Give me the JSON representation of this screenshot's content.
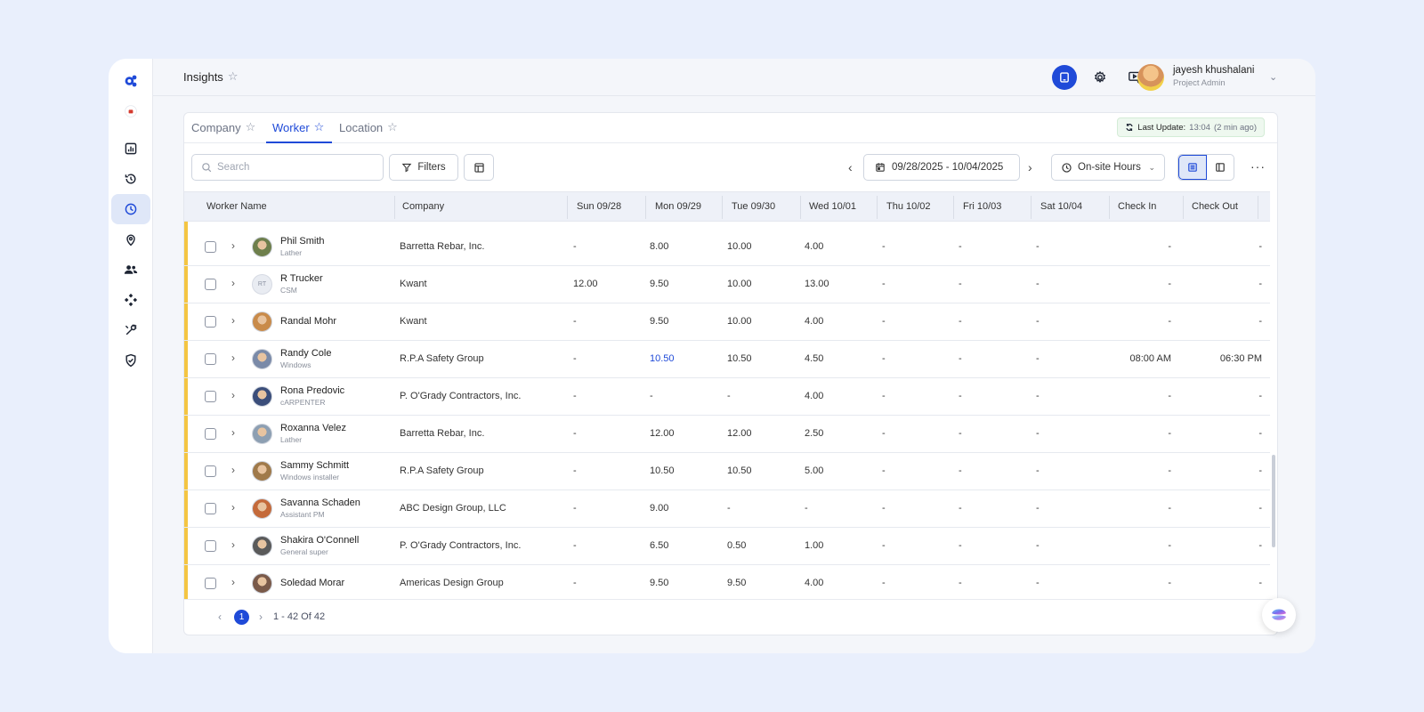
{
  "header": {
    "title": "Insights",
    "user_name": "jayesh khushalani",
    "user_role": "Project Admin"
  },
  "tabs": [
    {
      "label": "Company",
      "active": false
    },
    {
      "label": "Worker",
      "active": true
    },
    {
      "label": "Location",
      "active": false
    }
  ],
  "last_update": {
    "label": "Last Update:",
    "time": "13:04",
    "ago": "(2 min ago)"
  },
  "toolbar": {
    "search_placeholder": "Search",
    "filters_label": "Filters",
    "date_range": "09/28/2025 - 10/04/2025",
    "metric": "On-site Hours",
    "more": "···"
  },
  "table": {
    "columns": [
      "Worker Name",
      "Company",
      "Sun 09/28",
      "Mon 09/29",
      "Tue 09/30",
      "Wed 10/01",
      "Thu 10/02",
      "Fri 10/03",
      "Sat 10/04",
      "Check In",
      "Check Out"
    ],
    "rows": [
      {
        "name": "Phil Smith",
        "role": "Lather",
        "company": "Barretta Rebar, Inc.",
        "days": [
          "-",
          "8.00",
          "10.00",
          "4.00",
          "-",
          "-",
          "-"
        ],
        "check_in": "-",
        "check_out": "-"
      },
      {
        "name": "R Trucker",
        "role": "CSM",
        "initials": "RT",
        "company": "Kwant",
        "days": [
          "12.00",
          "9.50",
          "10.00",
          "13.00",
          "-",
          "-",
          "-"
        ],
        "check_in": "-",
        "check_out": "-"
      },
      {
        "name": "Randal Mohr",
        "role": "",
        "company": "Kwant",
        "days": [
          "-",
          "9.50",
          "10.00",
          "4.00",
          "-",
          "-",
          "-"
        ],
        "check_in": "-",
        "check_out": "-"
      },
      {
        "name": "Randy Cole",
        "role": "Windows",
        "company": "R.P.A Safety Group",
        "days": [
          "-",
          "10.50",
          "10.50",
          "4.50",
          "-",
          "-",
          "-"
        ],
        "check_in": "08:00 AM",
        "check_out": "06:30 PM",
        "highlight_day": 1
      },
      {
        "name": "Rona Predovic",
        "role": "cARPENTER",
        "company": "P. O'Grady Contractors, Inc.",
        "days": [
          "-",
          "-",
          "-",
          "4.00",
          "-",
          "-",
          "-"
        ],
        "check_in": "-",
        "check_out": "-"
      },
      {
        "name": "Roxanna Velez",
        "role": "Lather",
        "company": "Barretta Rebar, Inc.",
        "days": [
          "-",
          "12.00",
          "12.00",
          "2.50",
          "-",
          "-",
          "-"
        ],
        "check_in": "-",
        "check_out": "-"
      },
      {
        "name": "Sammy Schmitt",
        "role": "Windows installer",
        "company": "R.P.A Safety Group",
        "days": [
          "-",
          "10.50",
          "10.50",
          "5.00",
          "-",
          "-",
          "-"
        ],
        "check_in": "-",
        "check_out": "-"
      },
      {
        "name": "Savanna Schaden",
        "role": "Assistant PM",
        "company": "ABC Design Group, LLC",
        "days": [
          "-",
          "9.00",
          "-",
          "-",
          "-",
          "-",
          "-"
        ],
        "check_in": "-",
        "check_out": "-"
      },
      {
        "name": "Shakira O'Connell",
        "role": "General super",
        "company": "P. O'Grady Contractors, Inc.",
        "days": [
          "-",
          "6.50",
          "0.50",
          "1.00",
          "-",
          "-",
          "-"
        ],
        "check_in": "-",
        "check_out": "-"
      },
      {
        "name": "Soledad Morar",
        "role": "",
        "company": "Americas Design Group",
        "days": [
          "-",
          "9.50",
          "9.50",
          "4.00",
          "-",
          "-",
          "-"
        ],
        "check_in": "-",
        "check_out": "-"
      }
    ]
  },
  "pagination": {
    "current_page": "1",
    "info": "1 - 42 Of 42"
  },
  "colors": {
    "accent": "#1f4ad8",
    "row_marker": "#f4c542",
    "header_bg": "#eef1f8",
    "page_bg": "#e9effc"
  },
  "icons": {
    "sidebar": [
      "logo-icon",
      "project-badge-icon",
      "dashboard-chart-icon",
      "history-icon",
      "clock-icon",
      "location-pin-icon",
      "users-icon",
      "puzzle-icon",
      "tools-icon",
      "shield-check-icon"
    ],
    "topbar": [
      "tablet-icon",
      "gear-icon",
      "video-settings-icon"
    ]
  }
}
